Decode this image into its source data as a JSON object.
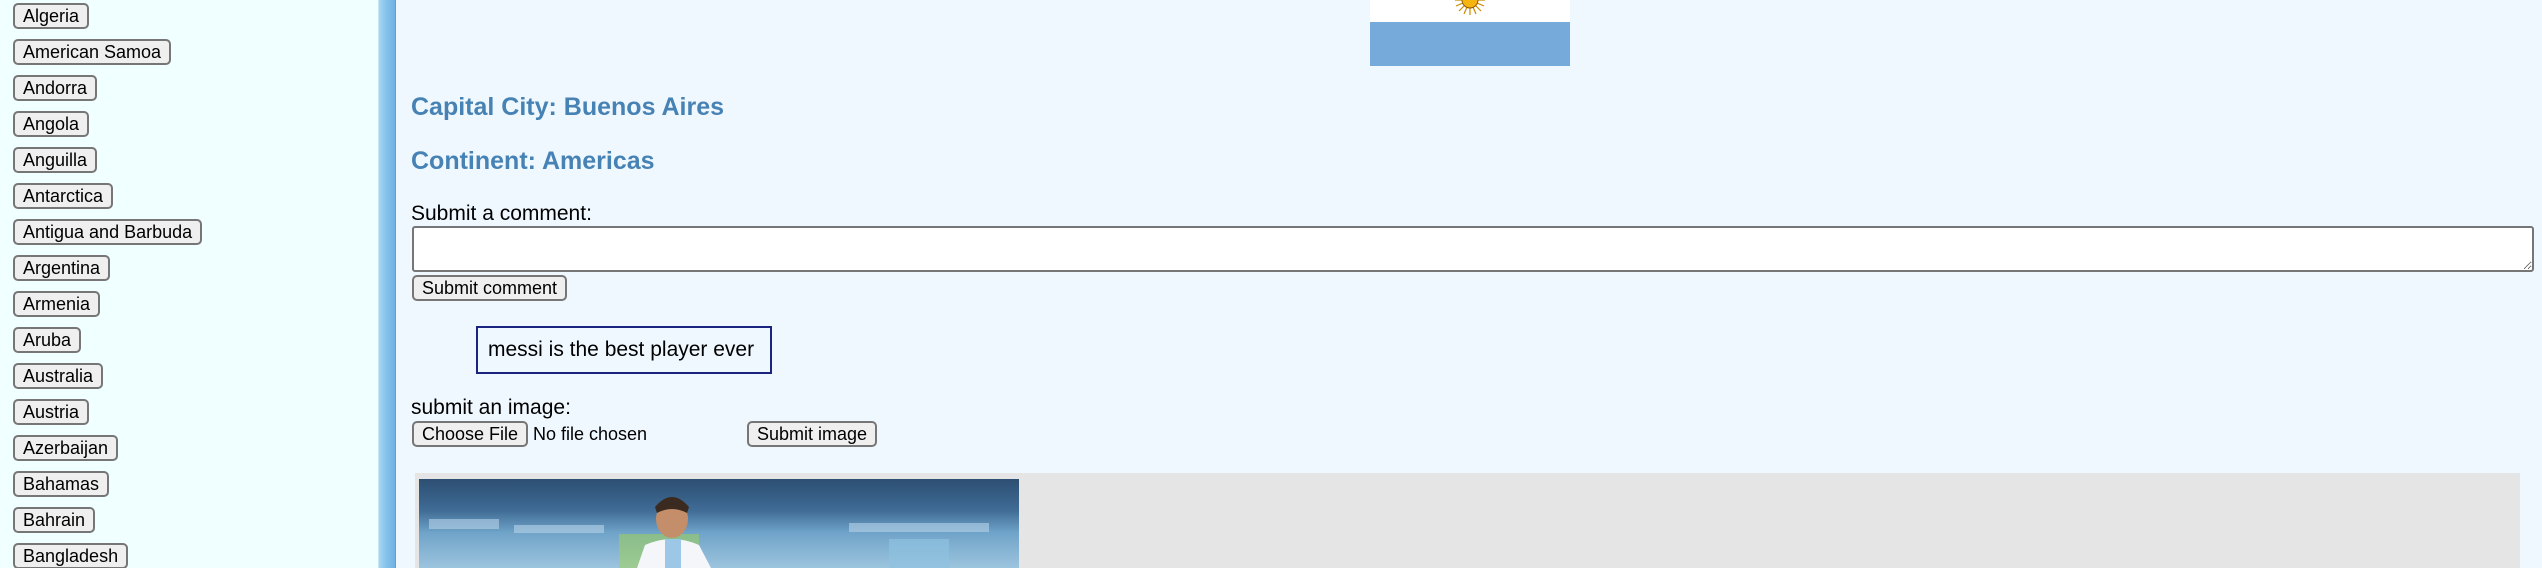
{
  "sidebar": {
    "countries": [
      "Algeria",
      "American Samoa",
      "Andorra",
      "Angola",
      "Anguilla",
      "Antarctica",
      "Antigua and Barbuda",
      "Argentina",
      "Armenia",
      "Aruba",
      "Australia",
      "Austria",
      "Azerbaijan",
      "Bahamas",
      "Bahrain",
      "Bangladesh"
    ]
  },
  "main": {
    "flag": {
      "icon": "argentina-flag",
      "colors": {
        "white": "#ffffff",
        "blue": "#75aadb",
        "sun": "#f6b40e"
      }
    },
    "capital_heading": "Capital City: Buenos Aires",
    "continent_heading": "Continent: Americas",
    "comment_label": "Submit a comment:",
    "comment_value": "",
    "submit_comment_label": "Submit comment",
    "comments": [
      "messi is the best player ever"
    ],
    "image_label": "submit an image:",
    "choose_file_label": "Choose File",
    "no_file_text": "No file chosen",
    "submit_image_label": "Submit image"
  },
  "colors": {
    "heading": "#4682b4",
    "page_bg": "#f0f8ff",
    "sidebar_bg": "#f0ffff",
    "comment_border": "#1a237e",
    "gallery_bg": "#e5e5e5"
  }
}
